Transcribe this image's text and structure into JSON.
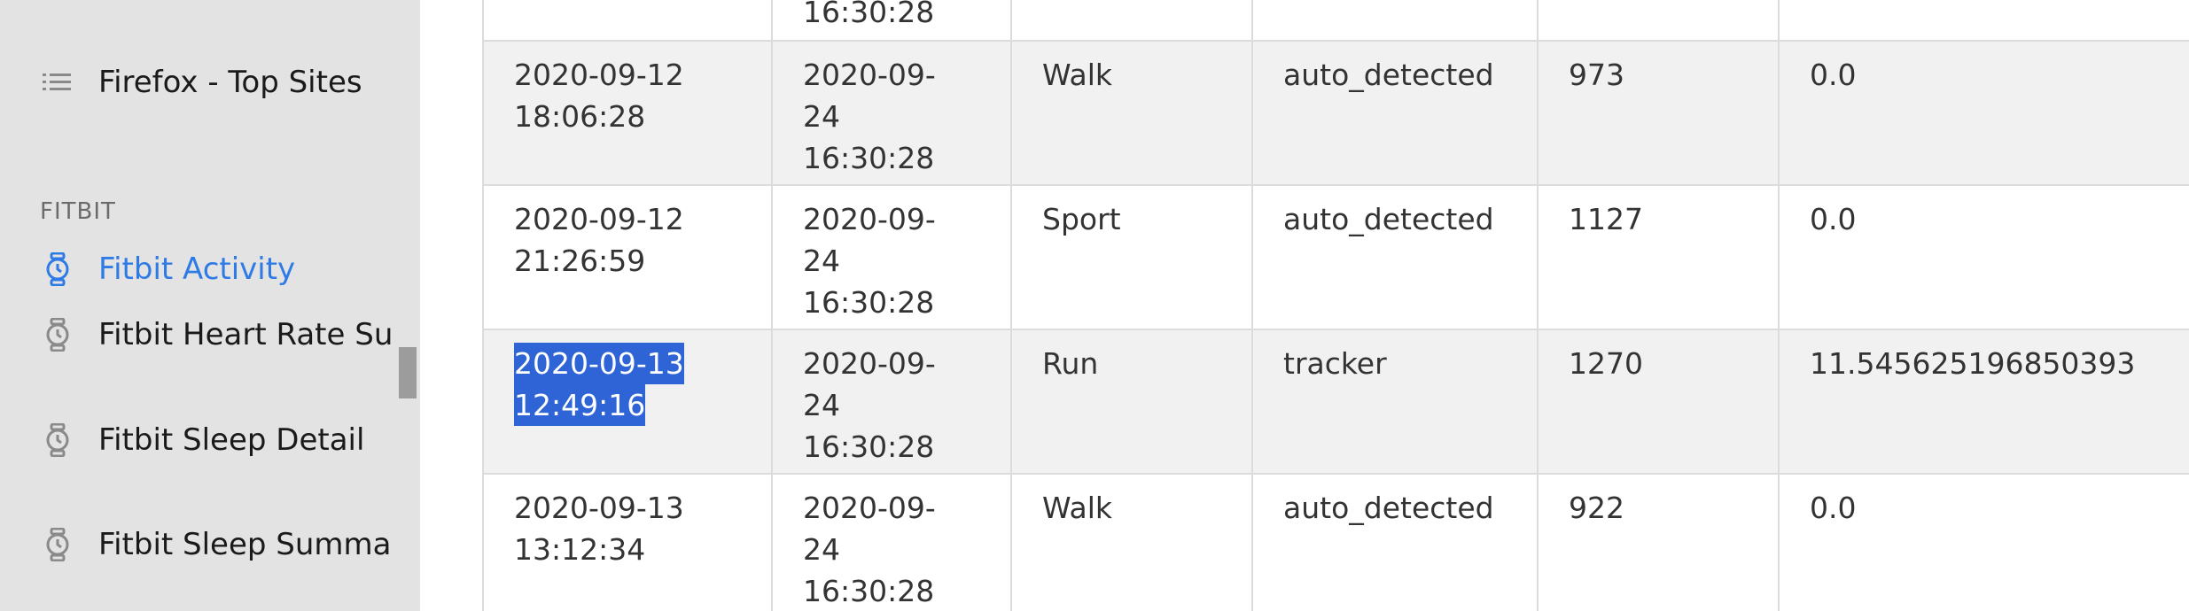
{
  "sidebar": {
    "items": [
      {
        "label": "Firefox - Top Sites",
        "icon": "list-icon",
        "active": false
      },
      {
        "label": "Fitbit Activity",
        "icon": "watch-icon",
        "active": true
      },
      {
        "label": "Fitbit Heart Rate Su",
        "icon": "watch-icon",
        "active": false
      },
      {
        "label": "Fitbit Sleep Detail",
        "icon": "watch-icon",
        "active": false
      },
      {
        "label": "Fitbit Sleep Summa",
        "icon": "watch-icon",
        "active": false
      }
    ],
    "section_title": "FITBIT"
  },
  "table": {
    "rows": [
      {
        "c1": [
          "",
          ""
        ],
        "c2": [
          "16:30:28"
        ],
        "c3": "",
        "c4": "",
        "c5": "",
        "c6": ""
      },
      {
        "c1": [
          "2020-09-12",
          "18:06:28"
        ],
        "c2": [
          "2020-09-",
          "24",
          "16:30:28"
        ],
        "c3": "Walk",
        "c4": "auto_detected",
        "c5": "973",
        "c6": "0.0"
      },
      {
        "c1": [
          "2020-09-12",
          "21:26:59"
        ],
        "c2": [
          "2020-09-",
          "24",
          "16:30:28"
        ],
        "c3": "Sport",
        "c4": "auto_detected",
        "c5": "1127",
        "c6": "0.0"
      },
      {
        "c1": [
          "2020-09-13",
          "12:49:16"
        ],
        "c2": [
          "2020-09-",
          "24",
          "16:30:28"
        ],
        "c3": "Run",
        "c4": "tracker",
        "c5": "1270",
        "c6": "11.545625196850393"
      },
      {
        "c1": [
          "2020-09-13",
          "13:12:34"
        ],
        "c2": [
          "2020-09-",
          "24",
          "16:30:28"
        ],
        "c3": "Walk",
        "c4": "auto_detected",
        "c5": "922",
        "c6": "0.0"
      }
    ]
  },
  "colors": {
    "sidebar_bg": "#e3e3e3",
    "active_accent": "#2f7be5",
    "selection_bg": "#2f64d6",
    "row_shade": "#f1f1f1"
  }
}
